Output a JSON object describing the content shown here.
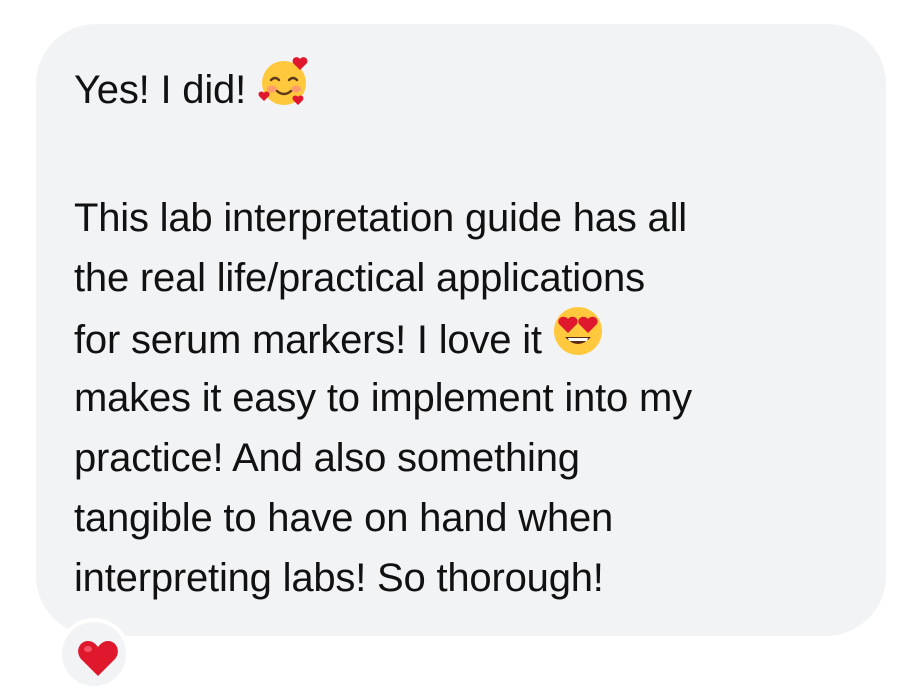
{
  "message": {
    "greeting": "Yes! I did!",
    "greeting_emoji": "smiling-face-with-hearts-icon",
    "lines": [
      "This lab interpretation guide has all",
      "the real life/practical applications",
      "for serum markers! I love it",
      "makes it easy to implement into my",
      "practice! And also something",
      "tangible to have on hand when",
      "interpreting labs! So thorough!"
    ],
    "inline_emoji": "heart-eyes-icon"
  },
  "reaction": {
    "icon": "red-heart-icon",
    "color": "#e0182d"
  },
  "colors": {
    "bubble_background": "#f2f3f5",
    "text": "#111111"
  }
}
